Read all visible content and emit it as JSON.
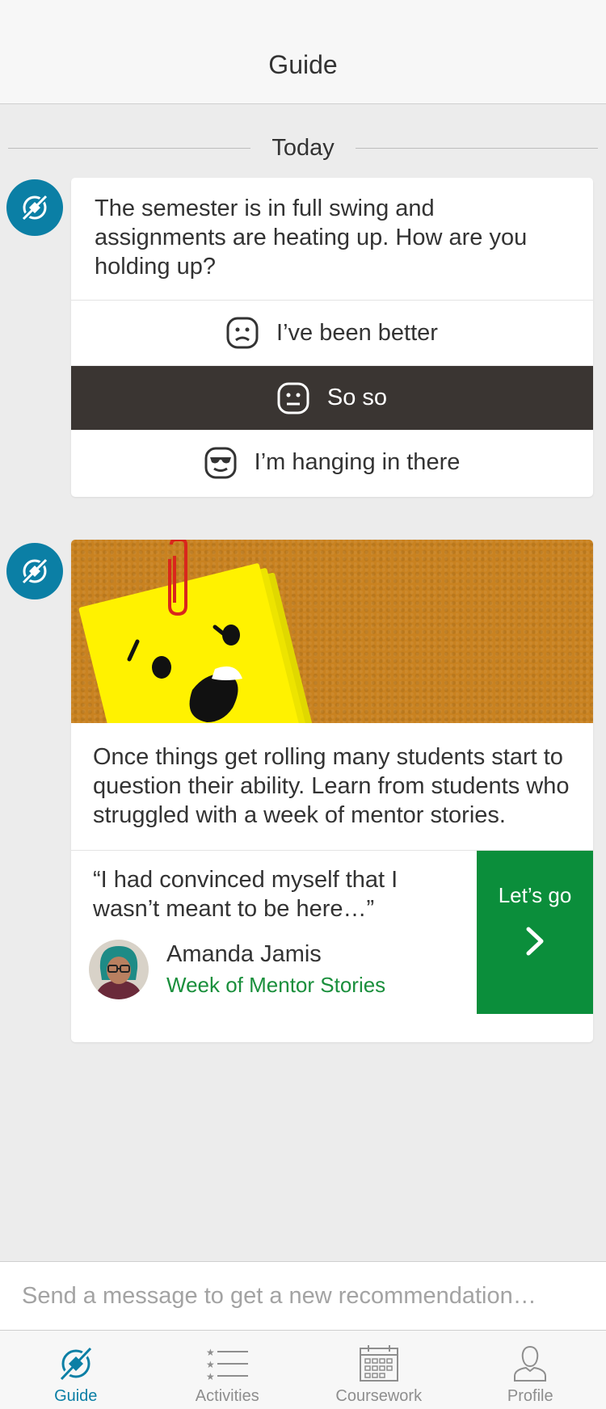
{
  "nav": {
    "title": "Guide"
  },
  "feed": {
    "date_label": "Today",
    "checkin": {
      "question": "The semester is in full swing and assignments are heating up. How are you holding up?",
      "options": [
        {
          "label": "I’ve been better",
          "icon": "sad-face-icon",
          "selected": false
        },
        {
          "label": "So so",
          "icon": "neutral-face-icon",
          "selected": true
        },
        {
          "label": "I’m hanging in there",
          "icon": "sunglasses-face-icon",
          "selected": false
        }
      ]
    },
    "story": {
      "image": "worried-sticky-note-on-corkboard",
      "body": "Once things get rolling many students start to question their ability. Learn from students who struggled with a week of mentor stories.",
      "quote": "“I had convinced myself that I wasn’t meant to be here…”",
      "author_name": "Amanda Jamis",
      "series": "Week of Mentor Stories",
      "cta_label": "Let’s go"
    }
  },
  "composer": {
    "placeholder": "Send a message to get a new recommendation…"
  },
  "tabs": [
    {
      "label": "Guide",
      "icon": "compass-icon",
      "active": true
    },
    {
      "label": "Activities",
      "icon": "list-icon",
      "active": false
    },
    {
      "label": "Coursework",
      "icon": "calendar-icon",
      "active": false
    },
    {
      "label": "Profile",
      "icon": "person-icon",
      "active": false
    }
  ],
  "colors": {
    "accent": "#0b7fa5",
    "cta_green": "#0b8e3b",
    "selected_option": "#3a3532",
    "series_link": "#1a8f3c"
  }
}
